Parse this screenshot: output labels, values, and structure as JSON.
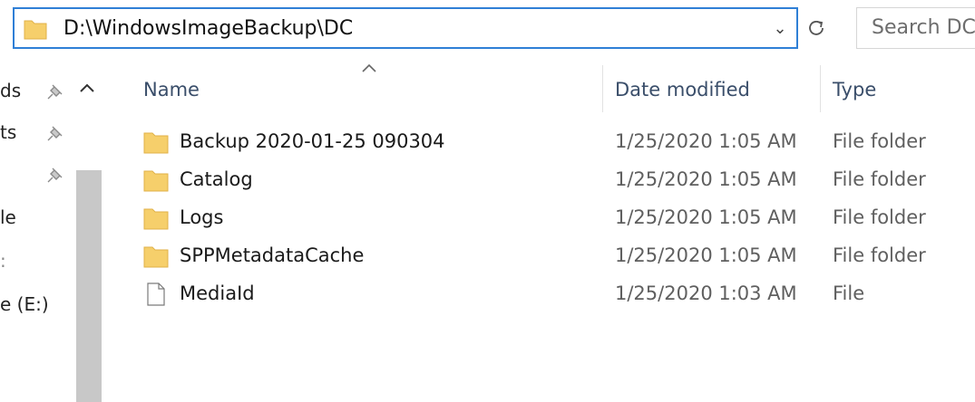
{
  "address_bar": {
    "path": "D:\\WindowsImageBackup\\DC"
  },
  "search": {
    "placeholder": "Search DC"
  },
  "nav_pane": {
    "items": [
      {
        "label": "ds"
      },
      {
        "label": "ts"
      },
      {
        "label": ""
      },
      {
        "label": "le"
      },
      {
        "label": ":"
      },
      {
        "label": "e (E:)"
      }
    ]
  },
  "columns": {
    "name": "Name",
    "date": "Date modified",
    "type": "Type"
  },
  "files": [
    {
      "name": "Backup 2020-01-25 090304",
      "date": "1/25/2020 1:05 AM",
      "type": "File folder",
      "icon": "folder-icon"
    },
    {
      "name": "Catalog",
      "date": "1/25/2020 1:05 AM",
      "type": "File folder",
      "icon": "folder-icon"
    },
    {
      "name": "Logs",
      "date": "1/25/2020 1:05 AM",
      "type": "File folder",
      "icon": "folder-icon"
    },
    {
      "name": "SPPMetadataCache",
      "date": "1/25/2020 1:05 AM",
      "type": "File folder",
      "icon": "folder-icon"
    },
    {
      "name": "MediaId",
      "date": "1/25/2020 1:03 AM",
      "type": "File",
      "icon": "file-icon"
    }
  ],
  "colors": {
    "accent": "#2f7fd6",
    "folder": "#f6cf6b",
    "header_text": "#3a4e6a"
  }
}
